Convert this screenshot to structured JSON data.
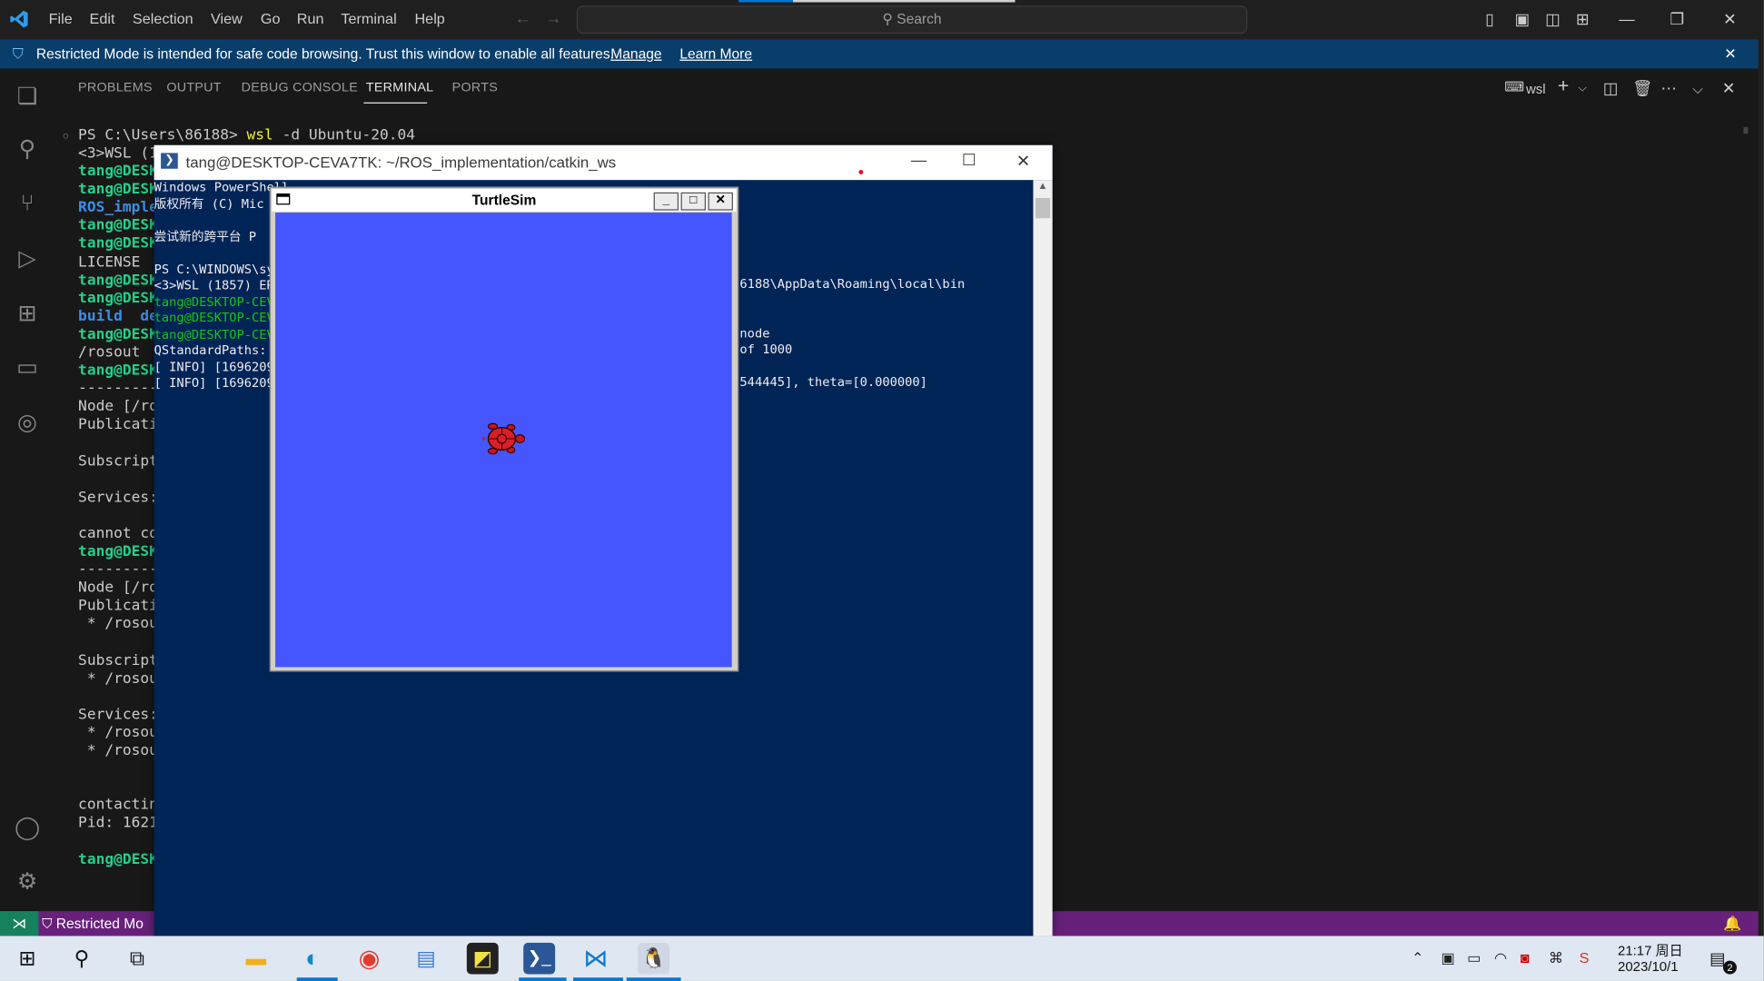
{
  "menu": [
    "File",
    "Edit",
    "Selection",
    "View",
    "Go",
    "Run",
    "Terminal",
    "Help"
  ],
  "search": {
    "placeholder": "Search"
  },
  "banner": {
    "message": "Restricted Mode is intended for safe code browsing. Trust this window to enable all features.",
    "manage": "Manage",
    "learn_more": "Learn More"
  },
  "panel": {
    "tabs": [
      "PROBLEMS",
      "OUTPUT",
      "DEBUG CONSOLE",
      "TERMINAL",
      "PORTS"
    ],
    "active_tab": "TERMINAL",
    "shell_label": "wsl"
  },
  "terminal": {
    "prompt": "PS C:\\Users\\86188> ",
    "cmd_wsl": "wsl",
    "cmd_args": " -d Ubuntu-20.04",
    "lines": [
      {
        "text": "<3>WSL (1",
        "cls": ""
      },
      {
        "text": "tang@DESKT",
        "cls": "green"
      },
      {
        "text": "tang@DESKT",
        "cls": "green"
      },
      {
        "text": "ROS_implem",
        "cls": "blue"
      },
      {
        "text": "tang@DESKT",
        "cls": "green"
      },
      {
        "text": "tang@DESKT",
        "cls": "green"
      },
      {
        "text": "LICENSE  L",
        "cls": ""
      },
      {
        "text": "tang@DESKT",
        "cls": "green"
      },
      {
        "text": "tang@DESKT",
        "cls": "green"
      },
      {
        "text": "build  de",
        "cls": "blue"
      },
      {
        "text": "tang@DESKT",
        "cls": "green"
      },
      {
        "text": "/rosout",
        "cls": ""
      },
      {
        "text": "tang@DESKT",
        "cls": "green"
      },
      {
        "text": "----------",
        "cls": ""
      },
      {
        "text": "Node [/ros",
        "cls": ""
      },
      {
        "text": "Publicatio",
        "cls": ""
      },
      {
        "text": "",
        "cls": ""
      },
      {
        "text": "Subscripti",
        "cls": ""
      },
      {
        "text": "",
        "cls": ""
      },
      {
        "text": "Services: ",
        "cls": ""
      },
      {
        "text": "",
        "cls": ""
      },
      {
        "text": "cannot con",
        "cls": ""
      },
      {
        "text": "tang@DESKT",
        "cls": "green"
      },
      {
        "text": "----------",
        "cls": ""
      },
      {
        "text": "Node [/ros",
        "cls": ""
      },
      {
        "text": "Publicatio",
        "cls": ""
      },
      {
        "text": " * /rosout",
        "cls": ""
      },
      {
        "text": "",
        "cls": ""
      },
      {
        "text": "Subscripti",
        "cls": ""
      },
      {
        "text": " * /rosout",
        "cls": ""
      },
      {
        "text": "",
        "cls": ""
      },
      {
        "text": "Services: ",
        "cls": ""
      },
      {
        "text": " * /rosout",
        "cls": ""
      },
      {
        "text": " * /rosout",
        "cls": ""
      },
      {
        "text": "",
        "cls": ""
      },
      {
        "text": "",
        "cls": ""
      },
      {
        "text": "contacting",
        "cls": ""
      },
      {
        "text": "Pid: 1621",
        "cls": ""
      },
      {
        "text": "",
        "cls": ""
      },
      {
        "text": "tang@DESKT",
        "cls": "green"
      }
    ]
  },
  "statusbar": {
    "restricted": "Restricted Mo"
  },
  "ps_window": {
    "title": "tang@DESKTOP-CEVA7TK: ~/ROS_implementation/catkin_ws",
    "lines_left": [
      {
        "text": "Windows PowerShell",
        "cls": ""
      },
      {
        "text": "版权所有 (C) Mic",
        "cls": ""
      },
      {
        "text": "",
        "cls": ""
      },
      {
        "text": "尝试新的跨平台 P",
        "cls": ""
      },
      {
        "text": "",
        "cls": ""
      },
      {
        "text": "PS C:\\WINDOWS\\sy",
        "cls": ""
      },
      {
        "text": "<3>WSL (1857) ER",
        "cls": ""
      },
      {
        "text": "tang@DESKTOP-CEV",
        "cls": "ps-green"
      },
      {
        "text": "tang@DESKTOP-CEV",
        "cls": "ps-green"
      },
      {
        "text": "tang@DESKTOP-CEV",
        "cls": "ps-green"
      },
      {
        "text": "QStandardPaths: ",
        "cls": ""
      },
      {
        "text": "[ INFO] [1696209",
        "cls": ""
      },
      {
        "text": "[ INFO] [1696209",
        "cls": ""
      }
    ],
    "right_path": "6188\\AppData\\Roaming\\local\\bin",
    "right_node": "node",
    "right_of": "of 1000",
    "right_theta": "544445], theta=[0.000000]"
  },
  "turtlesim": {
    "title": "TurtleSim",
    "bg_color": "#4556ff"
  },
  "taskbar": {
    "time": "21:17 周日",
    "date": "2023/10/1",
    "notifications": "2",
    "apps": [
      "start-icon",
      "search-icon",
      "task-view-icon",
      "file-explorer-icon",
      "edge-icon",
      "chrome-icon",
      "control-panel-icon",
      "sticky-notes-icon",
      "powershell-icon",
      "vscode-icon",
      "linux-tux-icon"
    ]
  },
  "colors": {
    "vscode_accent": "#0078d4",
    "statusbar": "#68217a",
    "powershell_bg": "#012456",
    "terminal_green": "#23d18b"
  }
}
